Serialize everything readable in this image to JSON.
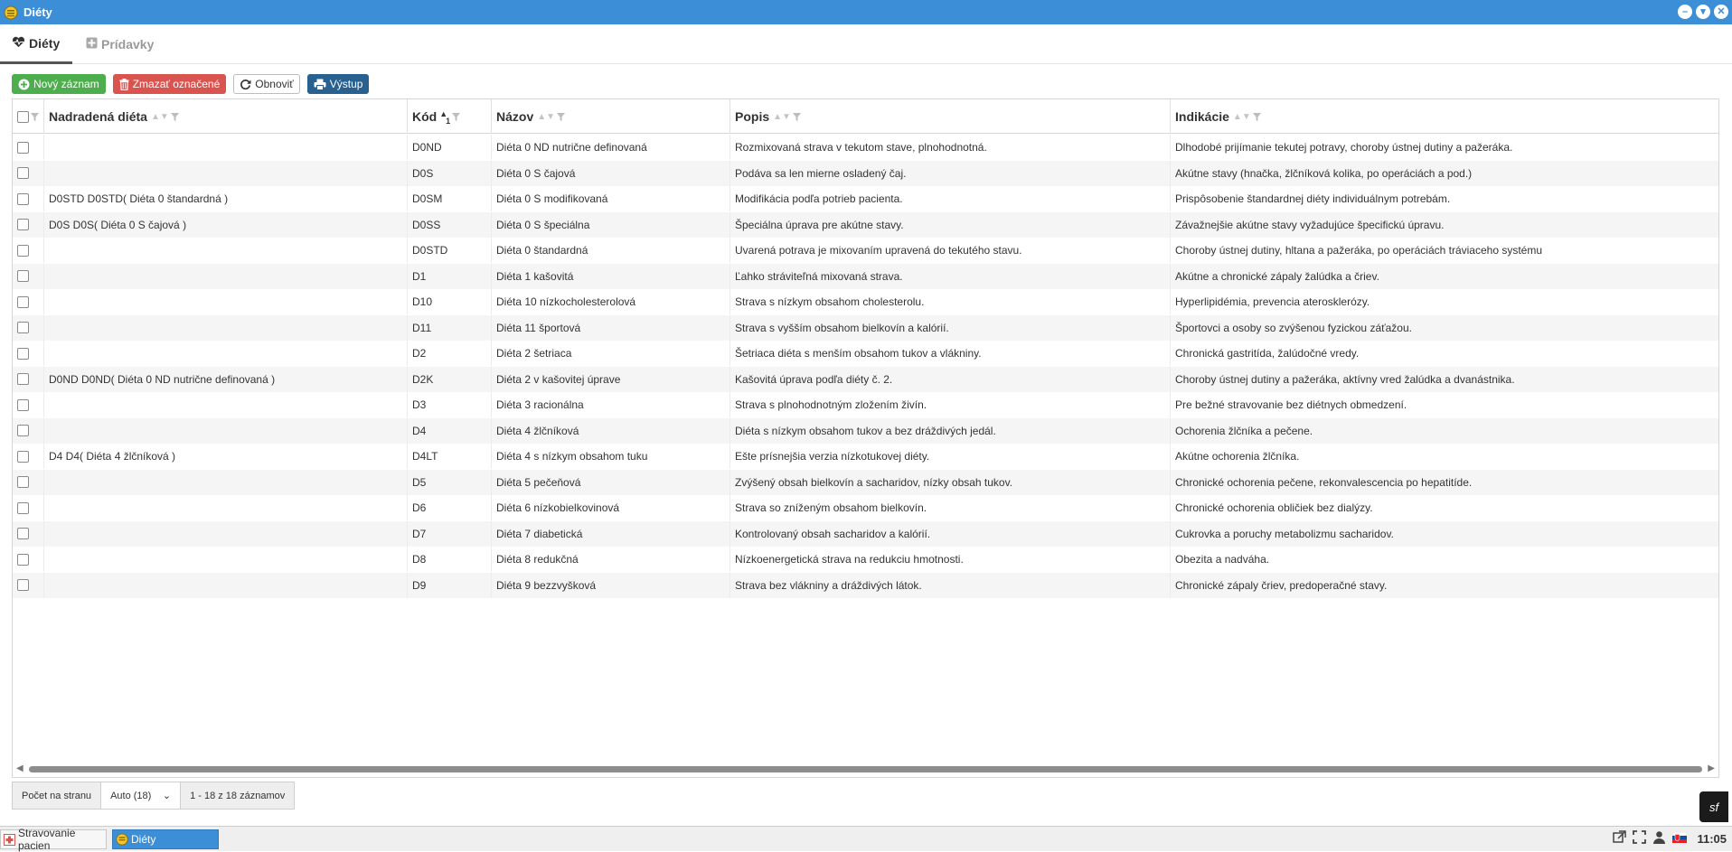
{
  "window": {
    "title": "Diéty",
    "controls": [
      "minimize",
      "maximize",
      "close"
    ]
  },
  "tabs": [
    {
      "label": "Diéty",
      "icon": "heartbeat-icon",
      "active": true
    },
    {
      "label": "Prídavky",
      "icon": "plus-square-icon",
      "active": false
    }
  ],
  "toolbar": {
    "new_label": "Nový záznam",
    "delete_label": "Zmazať označené",
    "refresh_label": "Obnoviť",
    "export_label": "Výstup"
  },
  "grid": {
    "columns": {
      "parent": "Nadradená diéta",
      "code": "Kód",
      "code_sort_index": "1",
      "name": "Názov",
      "desc": "Popis",
      "ind": "Indikácie"
    },
    "rows": [
      {
        "parent": "",
        "code": "D0ND",
        "name": "Diéta 0 ND nutrične definovaná",
        "desc": "Rozmixovaná strava v tekutom stave, plnohodnotná.",
        "ind": "Dlhodobé prijímanie tekutej potravy, choroby ústnej dutiny a pažeráka."
      },
      {
        "parent": "",
        "code": "D0S",
        "name": "Diéta 0 S čajová",
        "desc": "Podáva sa len mierne osladený čaj.",
        "ind": "Akútne stavy (hnačka, žlčníková kolika, po operáciách a pod.)"
      },
      {
        "parent": "D0STD D0STD( Diéta 0 štandardná )",
        "code": "D0SM",
        "name": "Diéta 0 S modifikovaná",
        "desc": "Modifikácia podľa potrieb pacienta.",
        "ind": "Prispôsobenie štandardnej diéty individuálnym potrebám."
      },
      {
        "parent": "D0S D0S( Diéta 0 S čajová )",
        "code": "D0SS",
        "name": "Diéta 0 S špeciálna",
        "desc": "Špeciálna úprava pre akútne stavy.",
        "ind": "Závažnejšie akútne stavy vyžadujúce špecifickú úpravu."
      },
      {
        "parent": "",
        "code": "D0STD",
        "name": "Diéta 0 štandardná",
        "desc": "Uvarená potrava je mixovaním upravená do tekutého stavu.",
        "ind": "Choroby ústnej dutiny, hltana a pažeráka, po operáciách tráviaceho systému"
      },
      {
        "parent": "",
        "code": "D1",
        "name": "Diéta 1 kašovitá",
        "desc": "Ľahko stráviteľná mixovaná strava.",
        "ind": "Akútne a chronické zápaly žalúdka a čriev."
      },
      {
        "parent": "",
        "code": "D10",
        "name": "Diéta 10 nízkocholesterolová",
        "desc": "Strava s nízkym obsahom cholesterolu.",
        "ind": "Hyperlipidémia, prevencia aterosklerózy."
      },
      {
        "parent": "",
        "code": "D11",
        "name": "Diéta 11 športová",
        "desc": "Strava s vyšším obsahom bielkovín a kalórií.",
        "ind": "Športovci a osoby so zvýšenou fyzickou záťažou."
      },
      {
        "parent": "",
        "code": "D2",
        "name": "Diéta 2 šetriaca",
        "desc": "Šetriaca diéta s menším obsahom tukov a vlákniny.",
        "ind": "Chronická gastritída, žalúdočné vredy."
      },
      {
        "parent": "D0ND D0ND( Diéta 0 ND nutrične definovaná )",
        "code": "D2K",
        "name": "Diéta 2 v kašovitej úprave",
        "desc": "Kašovitá úprava podľa diéty č. 2.",
        "ind": "Choroby ústnej dutiny a pažeráka, aktívny vred žalúdka a dvanástnika."
      },
      {
        "parent": "",
        "code": "D3",
        "name": "Diéta 3 racionálna",
        "desc": "Strava s plnohodnotným zložením živín.",
        "ind": "Pre bežné stravovanie bez diétnych obmedzení."
      },
      {
        "parent": "",
        "code": "D4",
        "name": "Diéta 4 žlčníková",
        "desc": "Diéta s nízkym obsahom tukov a bez dráždivých jedál.",
        "ind": "Ochorenia žlčníka a pečene."
      },
      {
        "parent": "D4 D4( Diéta 4 žlčníková )",
        "code": "D4LT",
        "name": "Diéta 4 s nízkym obsahom tuku",
        "desc": "Ešte prísnejšia verzia nízkotukovej diéty.",
        "ind": "Akútne ochorenia žlčníka."
      },
      {
        "parent": "",
        "code": "D5",
        "name": "Diéta 5 pečeňová",
        "desc": "Zvýšený obsah bielkovín a sacharidov, nízky obsah tukov.",
        "ind": "Chronické ochorenia pečene, rekonvalescencia po hepatitíde."
      },
      {
        "parent": "",
        "code": "D6",
        "name": "Diéta 6 nízkobielkovinová",
        "desc": "Strava so zníženým obsahom bielkovín.",
        "ind": "Chronické ochorenia obličiek bez dialýzy."
      },
      {
        "parent": "",
        "code": "D7",
        "name": "Diéta 7 diabetická",
        "desc": "Kontrolovaný obsah sacharidov a kalórií.",
        "ind": "Cukrovka a poruchy metabolizmu sacharidov."
      },
      {
        "parent": "",
        "code": "D8",
        "name": "Diéta 8 redukčná",
        "desc": "Nízkoenergetická strava na redukciu hmotnosti.",
        "ind": "Obezita a nadváha."
      },
      {
        "parent": "",
        "code": "D9",
        "name": "Diéta 9 bezzvyšková",
        "desc": "Strava bez vlákniny a dráždivých látok.",
        "ind": "Chronické zápaly čriev, predoperačné stavy."
      }
    ]
  },
  "pager": {
    "per_page_label": "Počet na stranu",
    "per_page_value": "Auto (18)",
    "range_label": "1 - 18 z 18 záznamov"
  },
  "symfony_badge": "sf",
  "taskbar": {
    "items": [
      {
        "label": "Stravovanie pacien",
        "active": false
      },
      {
        "label": "Diéty",
        "active": true
      }
    ],
    "clock": "11:05"
  },
  "colors": {
    "titlebar": "#3c8fd6",
    "new_button": "#4cae4c",
    "delete_button": "#d9534f",
    "export_button": "#286090"
  }
}
